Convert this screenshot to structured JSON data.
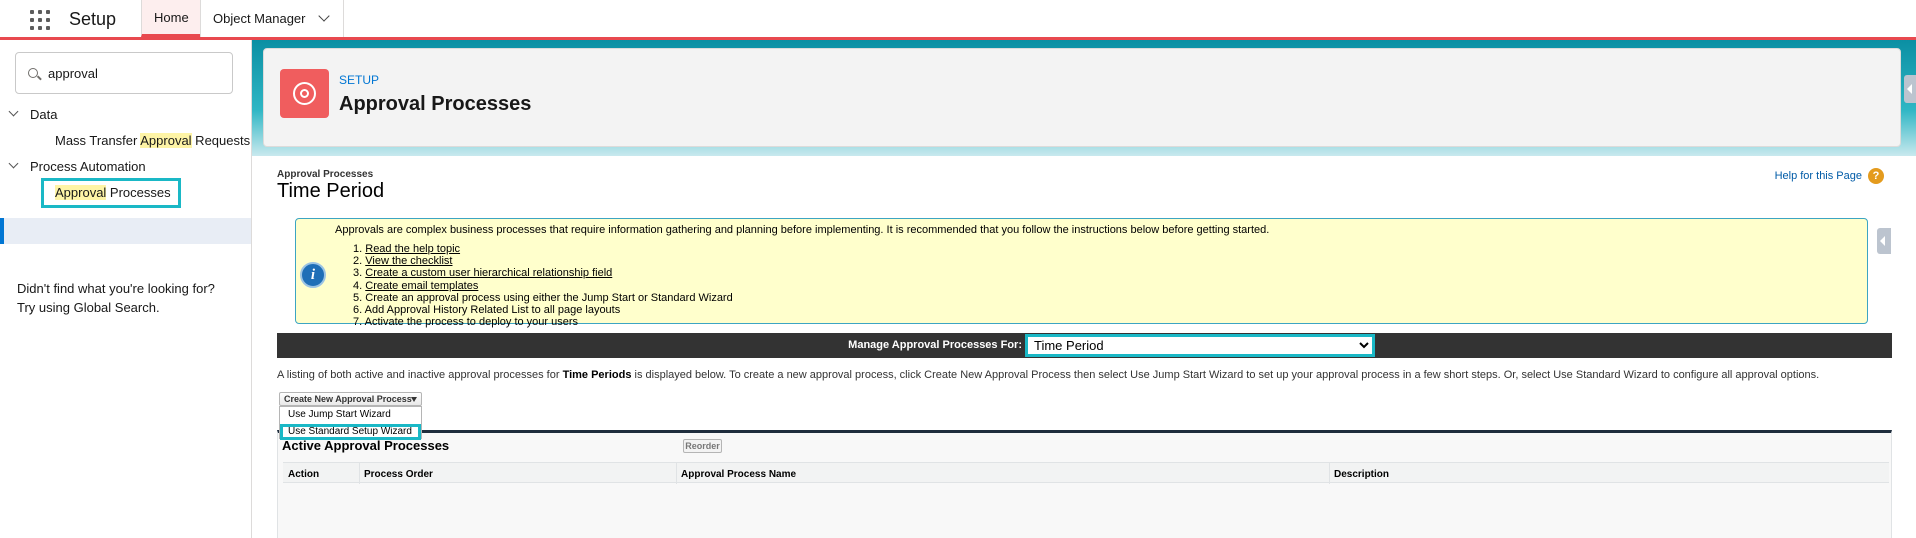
{
  "topbar": {
    "app_name": "Setup",
    "tabs": [
      {
        "label": "Home",
        "active": true
      },
      {
        "label": "Object Manager",
        "has_dropdown": true
      }
    ]
  },
  "sidebar": {
    "search": {
      "value": "approval"
    },
    "tree": [
      {
        "label": "Data",
        "items": [
          {
            "before": "Mass Transfer ",
            "highlight": "Approval",
            "after": " Requests"
          }
        ]
      },
      {
        "label": "Process Automation",
        "items": [
          {
            "before": "",
            "highlight": "Approval",
            "after": " Processes",
            "selected": true
          }
        ]
      }
    ],
    "help_line1": "Didn't find what you're looking for?",
    "help_line2": "Try using Global Search."
  },
  "header": {
    "eyebrow": "SETUP",
    "title": "Approval Processes",
    "icon": "gear-icon"
  },
  "page": {
    "breadcrumb": "Approval Processes",
    "title": "Time Period",
    "help_link": "Help for this Page",
    "help_icon": "?"
  },
  "info": {
    "icon": "i",
    "intro": "Approvals are complex business processes that require information gathering and planning before implementing. It is recommended that you follow the instructions below before getting started.",
    "steps": [
      {
        "num": "1.",
        "text": "Read the help topic",
        "link": true
      },
      {
        "num": "2.",
        "text": "View the checklist",
        "link": true
      },
      {
        "num": "3.",
        "text": "Create a custom user hierarchical relationship field",
        "link": true
      },
      {
        "num": "4.",
        "text": "Create email templates",
        "link": true
      },
      {
        "num": "5.",
        "text": "Create an approval process using either the Jump Start or Standard Wizard",
        "link": false
      },
      {
        "num": "6.",
        "text": "Add Approval History Related List to all page layouts",
        "link": false
      },
      {
        "num": "7.",
        "text": "Activate the process to deploy to your users",
        "link": false
      }
    ]
  },
  "manage": {
    "label": "Manage Approval Processes For:",
    "selected": "Time Period"
  },
  "listing": {
    "prefix": "A listing of both active and inactive approval processes for ",
    "object": "Time Periods",
    "suffix": " is displayed below. To create a new approval process, click Create New Approval Process then select Use Jump Start Wizard to set up your approval process in a few short steps. Or, select Use Standard Wizard to configure all approval options."
  },
  "create": {
    "button_label": "Create New Approval Process",
    "options": [
      "Use Jump Start Wizard",
      "Use Standard Setup Wizard"
    ]
  },
  "table": {
    "title": "Active Approval Processes",
    "reorder_label": "Reorder",
    "columns": [
      "Action",
      "Process Order",
      "Approval Process Name",
      "Description"
    ]
  },
  "colors": {
    "accent_red": "#e8494f",
    "focus_teal": "#1ab8c6",
    "brand_blue": "#0176d3",
    "info_bg": "#ffffcc"
  }
}
